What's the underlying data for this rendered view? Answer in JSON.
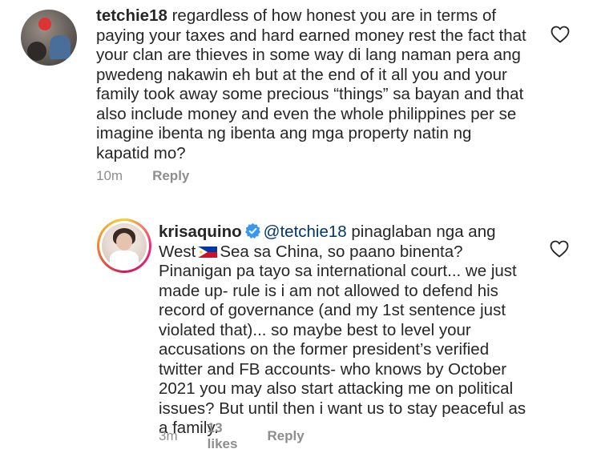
{
  "comments": [
    {
      "username": "tetchie18",
      "text": "regardless of how honest you are in terms of paying your taxes and hard earned money rest the fact that your clan are thieves in some way di lang naman pera ang pwedeng nakawin eh but at the end of it all you and your family took away some precious “things” sa bayan and that also include money and even the whole philippines per se imagine ibenta ng ibenta ang mga property natin ng kapatid mo?",
      "time": "10m",
      "reply_label": "Reply"
    },
    {
      "username": "krisaquino",
      "verified": true,
      "mention": "@tetchie18",
      "text_before_flag": "pinaglaban nga ang West",
      "flag_icon": "philippines-flag-icon",
      "text_after_flag": "Sea sa China, so paano binenta? Pinanigan pa tayo sa international court... we just made up- rule is i am not allowed to defend his record of governance (and my 1st sentence just violated that)... so maybe best to level your accusations on the former president’s verified twitter and FB accounts- who knows by October 2021 you may also start attacking me on political issues? But until then i want us to stay peaceful as a family.",
      "time": "3m",
      "likes": "13 likes",
      "reply_label": "Reply"
    }
  ],
  "colors": {
    "text": "#262626",
    "meta": "#8e8e8e",
    "mention": "#00376b",
    "verified": "#3897f0"
  },
  "icons": [
    "heart-icon",
    "verified-badge-icon",
    "philippines-flag-icon"
  ]
}
